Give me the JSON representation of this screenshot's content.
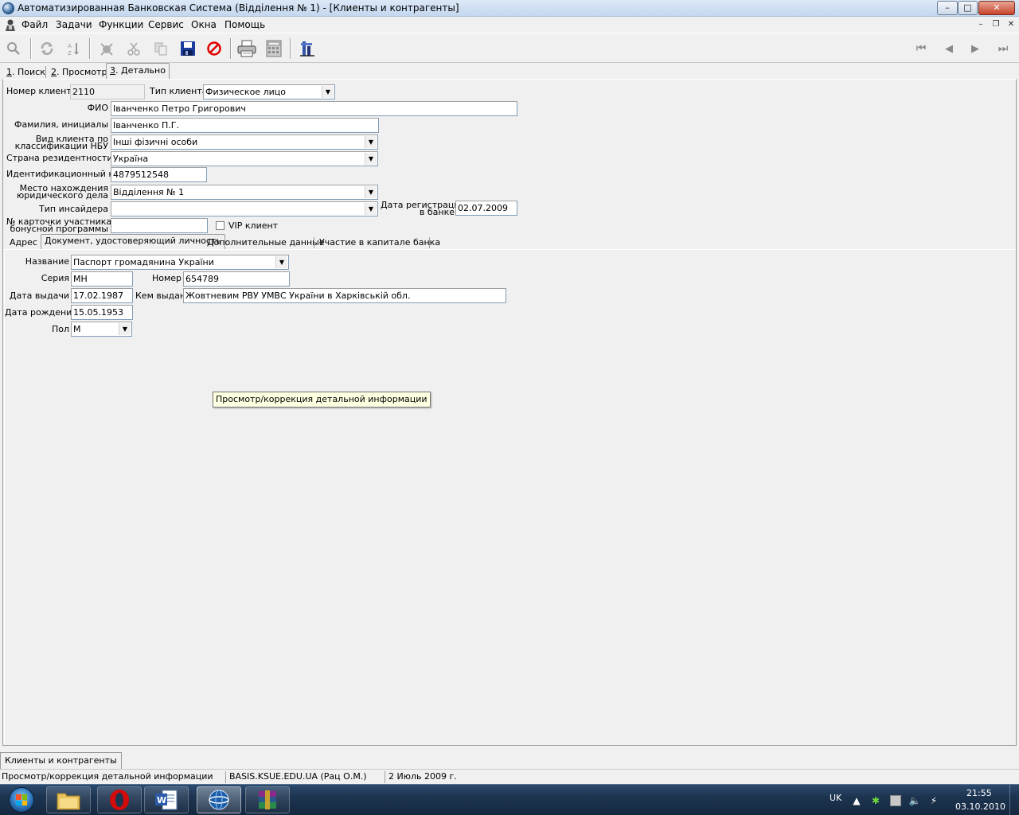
{
  "window": {
    "title": "Автоматизированная Банковская Система (Відділення № 1) - [Клиенты и контрагенты]",
    "controls": {
      "minimize": "–",
      "maximize": "□",
      "close": "✕"
    }
  },
  "menu": {
    "items": [
      "Файл",
      "Задачи",
      "Функции",
      "Сервис",
      "Окна",
      "Помощь"
    ],
    "mdi_controls": {
      "minimize": "–",
      "restore": "❐",
      "close": "✕"
    }
  },
  "toolbar": {
    "buttons": [
      "zoom-icon",
      "refresh-icon",
      "sort-icon",
      "delete-icon",
      "cut-icon",
      "copy-icon",
      "save-icon",
      "cancel-icon",
      "print-icon",
      "calculator-icon",
      "stats-icon"
    ],
    "nav": {
      "first": "⏮",
      "prev": "◀",
      "next": "▶",
      "last": "⏭"
    }
  },
  "outer_tabs": [
    {
      "key": "1",
      "label": ". Поиск"
    },
    {
      "key": "2",
      "label": ". Просмотр"
    },
    {
      "key": "3",
      "label": ". Детально",
      "active": true
    }
  ],
  "client": {
    "number_label": "Номер клиента",
    "number_value": "2110",
    "type_label": "Тип клиента",
    "type_value": "Физическое лицо",
    "fio_label": "ФИО",
    "fio_value": "Іванченко Петро Григорович",
    "initials_label": "Фамилия, инициалы",
    "initials_value": "Іванченко П.Г.",
    "nbu_label_1": "Вид клиента по",
    "nbu_label_2": "классификации НБУ",
    "nbu_value": "Інші фізичні особи",
    "country_label": "Страна резидентности",
    "country_value": "Україна",
    "id_code_label": "Идентификационный код",
    "id_code_value": "4879512548",
    "location_label_1": "Место нахождения",
    "location_label_2": "юридического дела",
    "location_value": "Відділення № 1",
    "insider_label": "Тип инсайдера",
    "insider_value": "",
    "reg_date_label_1": "Дата регистрации",
    "reg_date_label_2": "в банке",
    "reg_date_value": "02.07.2009",
    "bonus_label_1": "№ карточки участника",
    "bonus_label_2": "бонусной программы",
    "bonus_value": "",
    "vip_label": "VIP клиент",
    "vip_checked": false
  },
  "inner_tabs": [
    {
      "label": "Адрес"
    },
    {
      "label": "Документ, удостоверяющий личность",
      "active": true
    },
    {
      "label": "Дополнительные данные"
    },
    {
      "label": "Участие в капитале банка"
    }
  ],
  "document": {
    "name_label": "Название",
    "name_value": "Паспорт громадянина України",
    "series_label": "Серия",
    "series_value": "МН",
    "number_label": "Номер",
    "number_value": "654789",
    "issue_date_label": "Дата выдачи",
    "issue_date_value": "17.02.1987",
    "issued_by_label": "Кем выдан",
    "issued_by_value": "Жовтневим РВУ УМВС України в Харківській обл.",
    "birth_date_label": "Дата рождения",
    "birth_date_value": "15.05.1953",
    "sex_label": "Пол",
    "sex_value": "М"
  },
  "tooltip": "Просмотр/коррекция детальной информации",
  "mdi_tab": "Клиенты и контрагенты",
  "status": {
    "mode": "Просмотр/коррекция детальной информации",
    "server": "BASIS.KSUE.EDU.UA (Рац О.М.)",
    "date": "2 Июль 2009 г."
  },
  "taskbar": {
    "apps": [
      "explorer-icon",
      "opera-icon",
      "word-icon",
      "abs-icon",
      "winrar-icon"
    ],
    "lang": "UK",
    "time": "21:55",
    "date": "03.10.2010"
  },
  "colors": {
    "titlebar": "#c4d7ee",
    "window_bg": "#f0f0f0",
    "tooltip_bg": "#ffffe1",
    "taskbar": "#1d3450",
    "save_icon": "#1a3c9c",
    "cancel_icon": "#e00000"
  }
}
